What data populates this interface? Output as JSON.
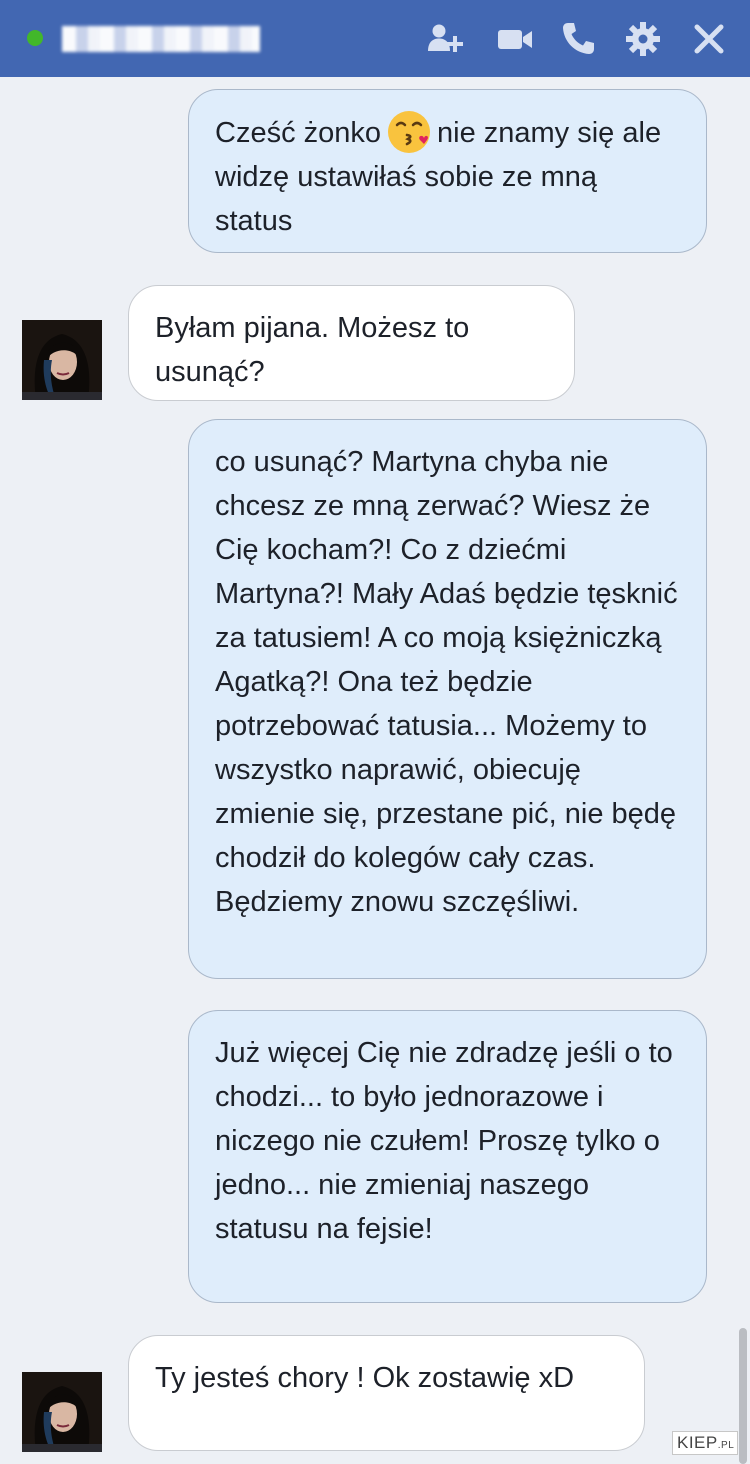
{
  "header": {
    "contact_name": "",
    "icons": {
      "add_people": "add-people-icon",
      "video_call": "video-camera-icon",
      "voice_call": "phone-icon",
      "settings": "gear-icon",
      "close": "close-icon"
    },
    "colors": {
      "bar": "#4267b2",
      "online": "#42b72a"
    }
  },
  "messages": [
    {
      "direction": "outgoing",
      "text_before_emoji": "Cześć żonko",
      "emoji": "kissing-face-emoji",
      "text_after_emoji": "nie znamy się ale widzę ustawiłaś sobie ze mną status"
    },
    {
      "direction": "incoming",
      "text": "Byłam pijana. Możesz to usunąć?"
    },
    {
      "direction": "outgoing",
      "text": "co usunąć? Martyna chyba nie chcesz ze mną zerwać? Wiesz że Cię kocham?! Co z dziećmi Martyna?! Mały Adaś będzie tęsknić za tatusiem! A co moją księżniczką Agatką?! Ona też będzie potrzebować tatusia... Możemy to wszystko naprawić, obiecuję zmienie się, przestane pić, nie będę chodził do kolegów cały czas. Będziemy znowu szczęśliwi."
    },
    {
      "direction": "outgoing",
      "text": "Już więcej Cię nie zdradzę jeśli o to chodzi... to było jednorazowe i niczego nie czułem! Proszę tylko o jedno... nie zmieniaj naszego statusu na fejsie!"
    },
    {
      "direction": "incoming",
      "text": "Ty jesteś chory ! Ok zostawię xD"
    }
  ],
  "bubble_colors": {
    "outgoing": "#dfedfb",
    "incoming": "#ffffff"
  },
  "watermark": {
    "main": "KIEP",
    "suffix": ".PL"
  }
}
